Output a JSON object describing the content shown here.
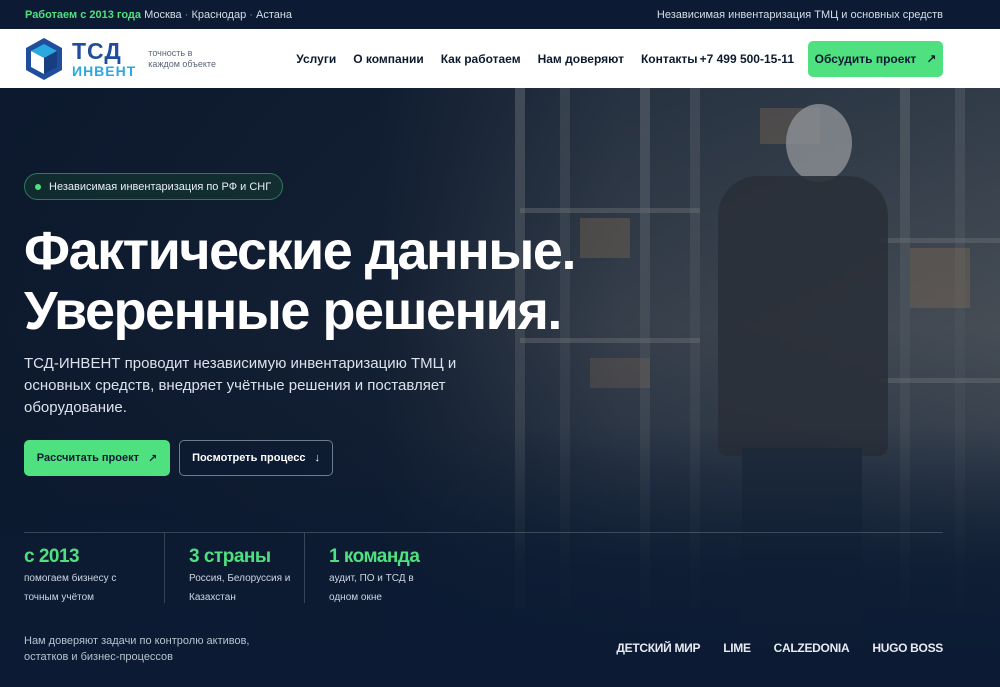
{
  "topbar": {
    "since": "Работаем с 2013 года",
    "cities": [
      "Москва",
      "Краснодар",
      "Астана"
    ],
    "right_text": "Независимая инвентаризация ТМЦ и основных средств"
  },
  "header": {
    "logo_line1": "ТСД",
    "logo_line2": "ИНВЕНТ",
    "tagline": "точность в каждом объекте",
    "nav": [
      "Услуги",
      "О компании",
      "Как работаем",
      "Нам доверяют",
      "Контакты"
    ],
    "phone": "+7 499 500-15-11",
    "cta_label": "Обсудить проект",
    "cta_icon": "arrow-up-right-icon"
  },
  "hero": {
    "pill": "Независимая инвентаризация по РФ и СНГ",
    "headline_line1": "Фактические данные.",
    "headline_line2": "Уверенные решения.",
    "lead": "ТСД-ИНВЕНТ проводит независимую инвентаризацию ТМЦ и основных средств, внедряет учётные решения и поставляет оборудование.",
    "primary_label": "Рассчитать проект",
    "secondary_label": "Посмотреть процесс",
    "stats": [
      {
        "value": "с 2013",
        "desc": "помогаем бизнесу с точным учётом"
      },
      {
        "value": "3 страны",
        "desc": "Россия, Белоруссия и Казахстан"
      },
      {
        "value": "1 команда",
        "desc": "аудит, ПО и ТСД в одном окне"
      }
    ],
    "trust_note": "Нам доверяют задачи по контролю активов, остатков и бизнес-процессов",
    "brands": [
      "ДЕТСКИЙ МИР",
      "LIME",
      "CALZEDONIA",
      "HUGO BOSS"
    ]
  },
  "colors": {
    "accent": "#4fe07f",
    "navy": "#0c1b33",
    "logo_blue": "#1f4e9d",
    "logo_cyan": "#2aa9e0"
  }
}
